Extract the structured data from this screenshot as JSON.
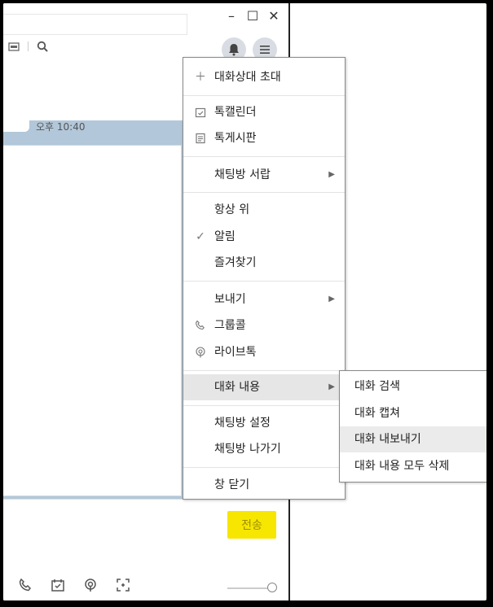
{
  "window": {
    "minimize": "–",
    "maximize": "☐",
    "close": "✕"
  },
  "chat": {
    "time": "오후 10:40",
    "send_label": "전송"
  },
  "menu": {
    "items": [
      {
        "label": "대화상대 초대",
        "icon": "plus-icon"
      },
      {
        "label": "톡캘린더",
        "icon": "calendar-icon"
      },
      {
        "label": "톡게시판",
        "icon": "board-icon"
      },
      {
        "label": "채팅방 서랍",
        "submenu": true
      },
      {
        "label": "항상 위"
      },
      {
        "label": "알림",
        "icon": "check-icon"
      },
      {
        "label": "즐겨찾기"
      },
      {
        "label": "보내기",
        "submenu": true
      },
      {
        "label": "그룹콜",
        "icon": "phone-icon"
      },
      {
        "label": "라이브톡",
        "icon": "live-icon"
      },
      {
        "label": "대화 내용",
        "submenu": true,
        "highlighted": true
      },
      {
        "label": "채팅방 설정"
      },
      {
        "label": "채팅방 나가기"
      },
      {
        "label": "창 닫기"
      }
    ]
  },
  "submenu": {
    "items": [
      {
        "label": "대화 검색"
      },
      {
        "label": "대화 캡쳐"
      },
      {
        "label": "대화 내보내기",
        "highlighted": true
      },
      {
        "label": "대화 내용 모두 삭제"
      }
    ]
  }
}
